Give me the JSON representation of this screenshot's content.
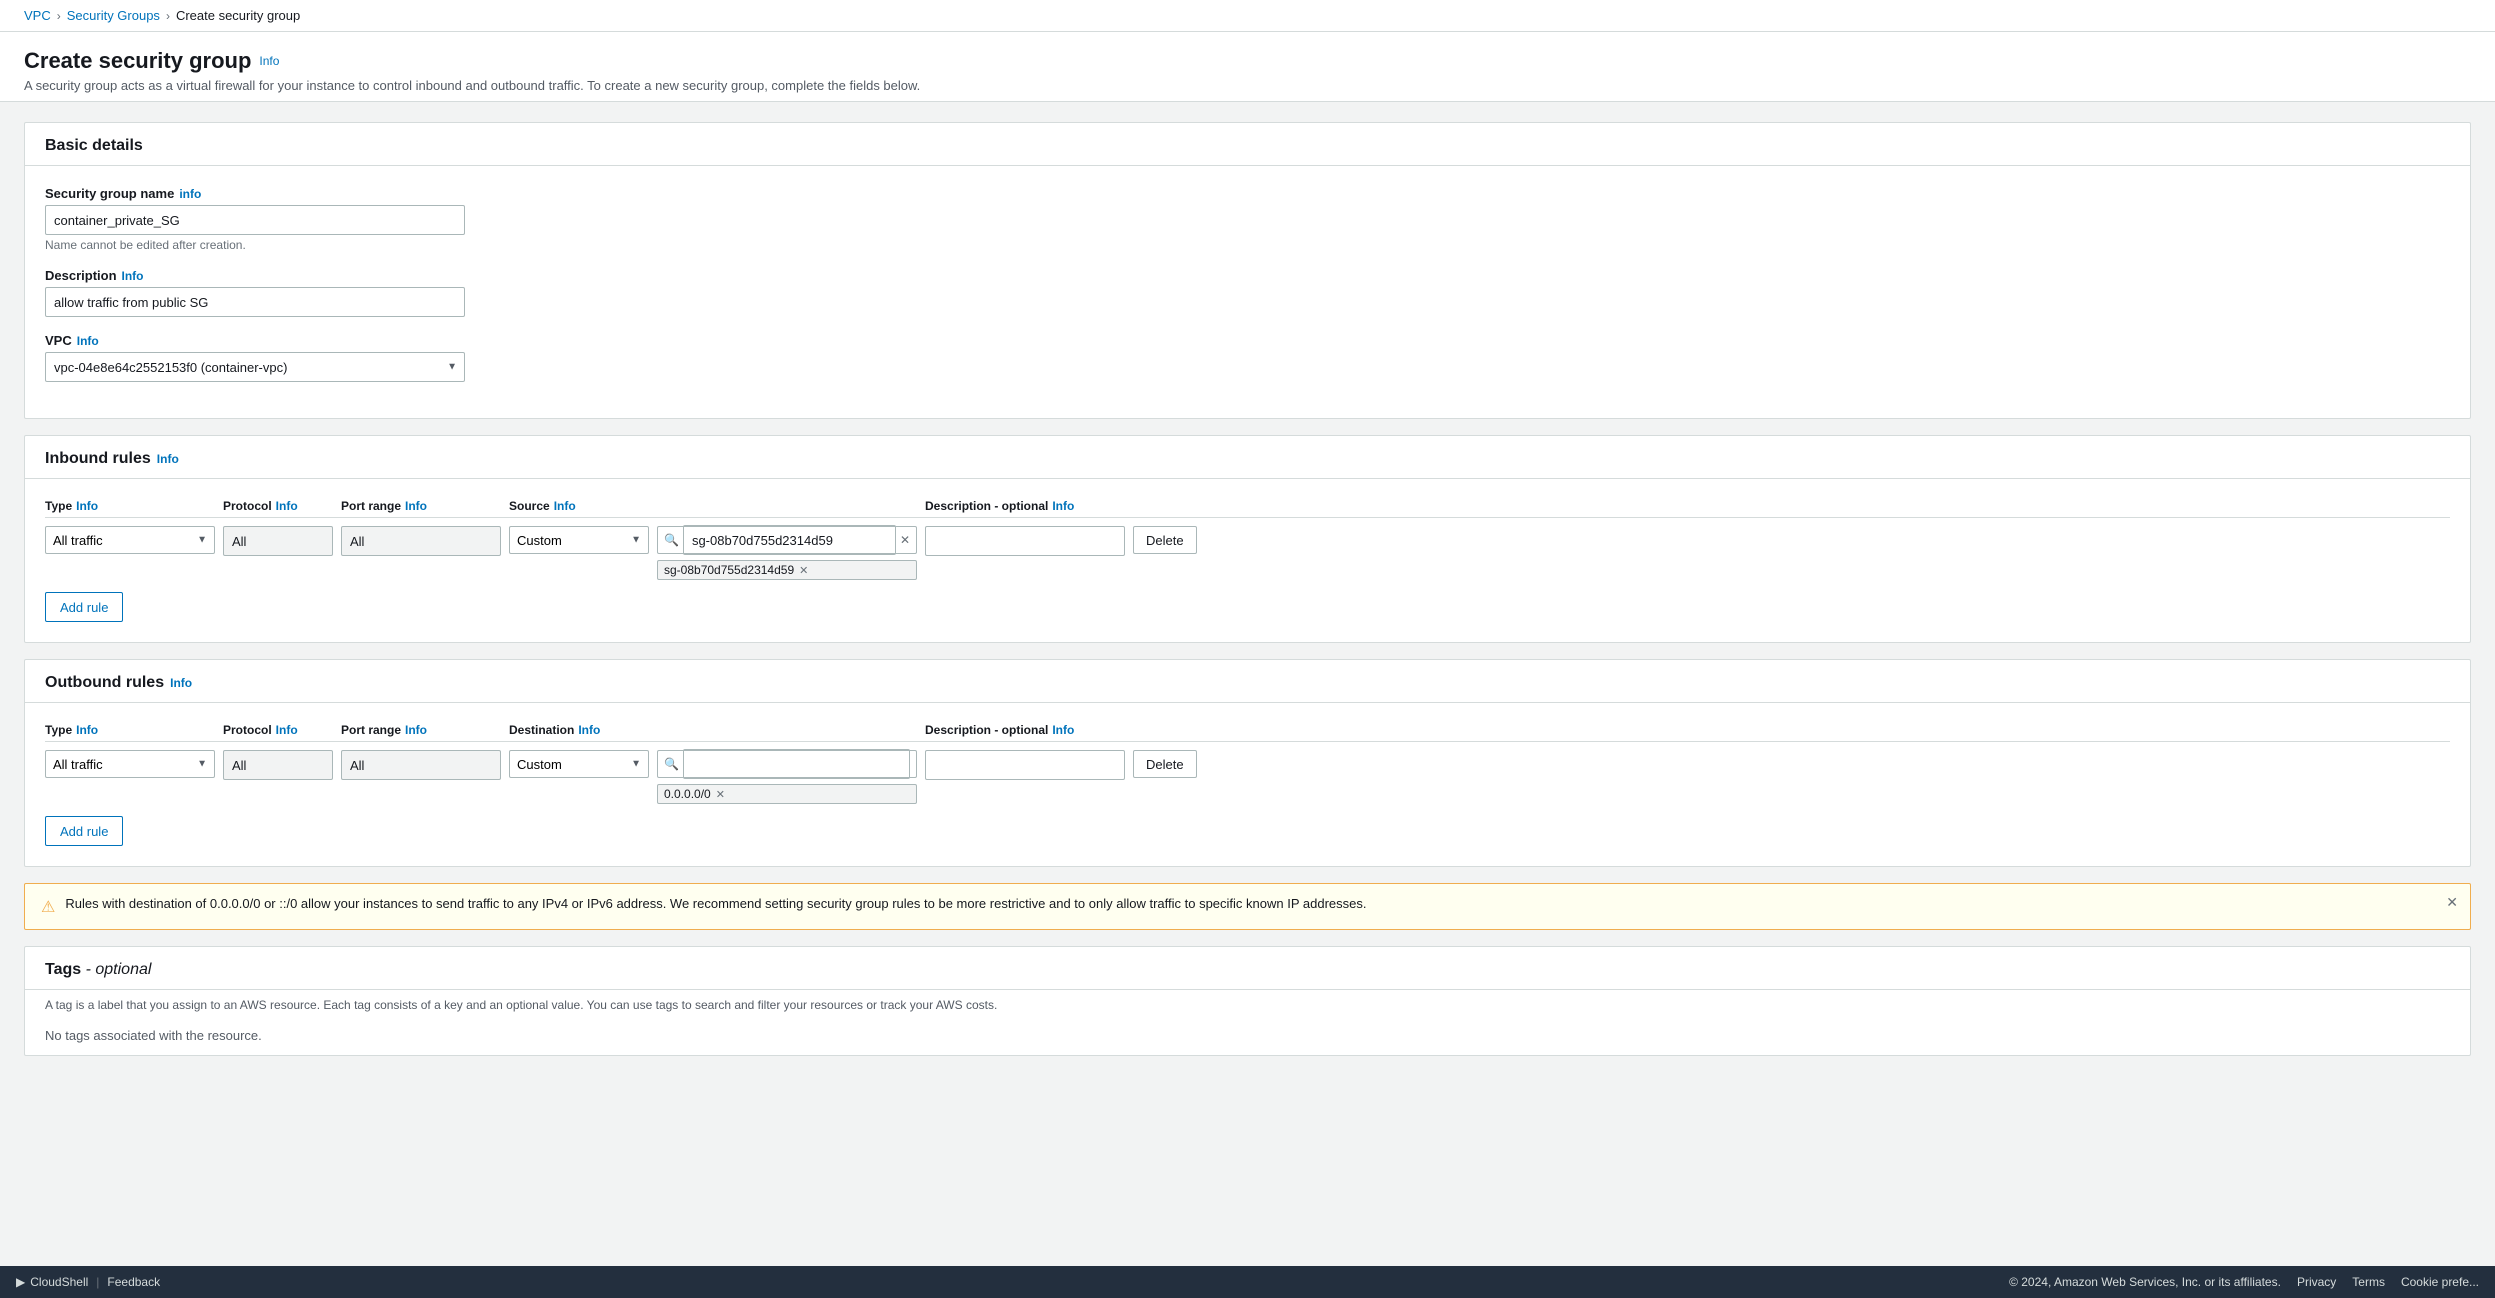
{
  "breadcrumb": {
    "vpc_label": "VPC",
    "vpc_href": "#",
    "security_groups_label": "Security Groups",
    "security_groups_href": "#",
    "current_label": "Create security group"
  },
  "page": {
    "title": "Create security group",
    "info_label": "Info",
    "description": "A security group acts as a virtual firewall for your instance to control inbound and outbound traffic. To create a new security group, complete the fields below."
  },
  "basic_details": {
    "section_title": "Basic details",
    "name_label": "Security group name",
    "name_info": "info",
    "name_value": "container_private_SG",
    "name_hint": "Name cannot be edited after creation.",
    "description_label": "Description",
    "description_info": "Info",
    "description_value": "allow traffic from public SG",
    "vpc_label": "VPC",
    "vpc_info": "Info",
    "vpc_value": "vpc-04e8e64c2552153f0 (container-vpc)"
  },
  "inbound_rules": {
    "section_title": "Inbound rules",
    "info_label": "Info",
    "col_type": "Type",
    "col_type_info": "Info",
    "col_protocol": "Protocol",
    "col_protocol_info": "Info",
    "col_port_range": "Port range",
    "col_port_info": "Info",
    "col_source": "Source",
    "col_source_info": "Info",
    "col_description": "Description - optional",
    "col_description_info": "Info",
    "rule": {
      "type_value": "All traffic",
      "protocol_value": "All",
      "port_value": "All",
      "source_type": "Custom",
      "source_search": "sg-08b70d755d2314d59",
      "source_token": "sg-08b70d755d2314d59",
      "description_value": "",
      "delete_label": "Delete"
    },
    "add_rule_label": "Add rule"
  },
  "outbound_rules": {
    "section_title": "Outbound rules",
    "info_label": "Info",
    "col_type": "Type",
    "col_type_info": "Info",
    "col_protocol": "Protocol",
    "col_protocol_info": "Info",
    "col_port_range": "Port range",
    "col_port_info": "Info",
    "col_destination": "Destination",
    "col_destination_info": "Info",
    "col_description": "Description - optional",
    "col_description_info": "Info",
    "rule": {
      "type_value": "All traffic",
      "protocol_value": "All",
      "port_value": "All",
      "dest_type": "Custom",
      "dest_search": "",
      "dest_token": "0.0.0.0/0",
      "description_value": "",
      "delete_label": "Delete"
    },
    "add_rule_label": "Add rule"
  },
  "alert": {
    "text": "Rules with destination of 0.0.0.0/0 or ::/0 allow your instances to send traffic to any IPv4 or IPv6 address. We recommend setting security group rules to be more restrictive and to only allow traffic to specific known IP addresses."
  },
  "tags": {
    "section_title": "Tags",
    "optional_label": "- optional",
    "description": "A tag is a label that you assign to an AWS resource. Each tag consists of a key and an optional value. You can use tags to search and filter your resources or track your AWS costs.",
    "no_tags_text": "No tags associated with the resource."
  },
  "footer": {
    "cloudshell_label": "CloudShell",
    "feedback_label": "Feedback",
    "copyright": "© 2024, Amazon Web Services, Inc. or its affiliates.",
    "terms_label": "Terms",
    "privacy_label": "Privacy",
    "cookie_label": "Cookie prefe..."
  }
}
